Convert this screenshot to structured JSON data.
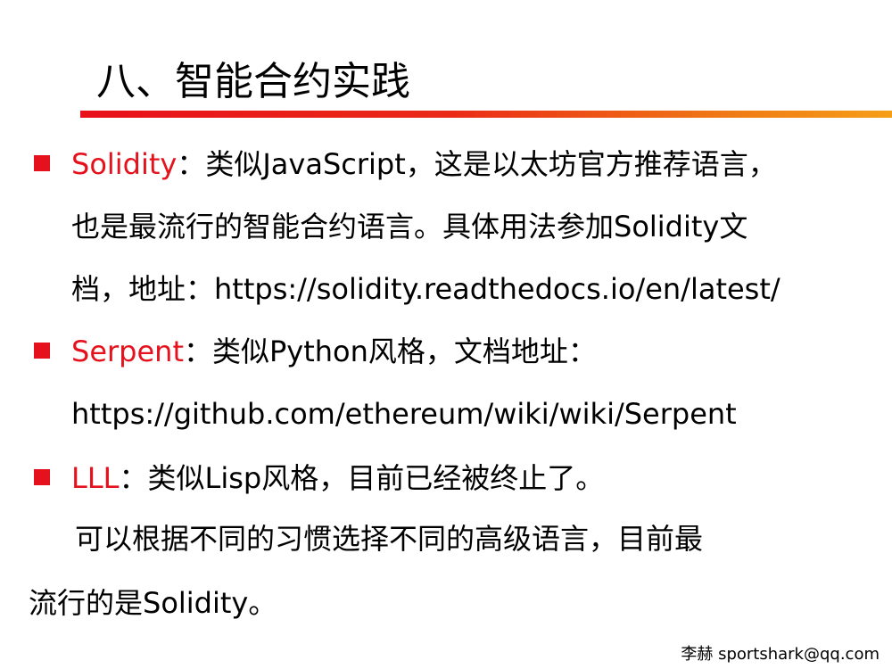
{
  "slide": {
    "title": "八、智能合约实践"
  },
  "bullets": [
    {
      "term": "Solidity",
      "lines": [
        "：类似JavaScript，这是以太坊官方推荐语言，",
        "也是最流行的智能合约语言。具体用法参加Solidity文",
        "档，地址：https://solidity.readthedocs.io/en/latest/"
      ]
    },
    {
      "term": "Serpent",
      "lines": [
        "：类似Python风格，文档地址：",
        "https://github.com/ethereum/wiki/wiki/Serpent"
      ]
    },
    {
      "term": "LLL",
      "lines": [
        "：类似Lisp风格，目前已经被终止了。"
      ]
    }
  ],
  "summary": {
    "line1": "可以根据不同的习惯选择不同的高级语言，目前最",
    "line2": "流行的是Solidity。"
  },
  "footer": {
    "text": "李赫 sportshark@qq.com"
  },
  "colors": {
    "accent_red": "#e5111c",
    "rule_start": "#e8101b",
    "rule_end": "#f59e18"
  }
}
